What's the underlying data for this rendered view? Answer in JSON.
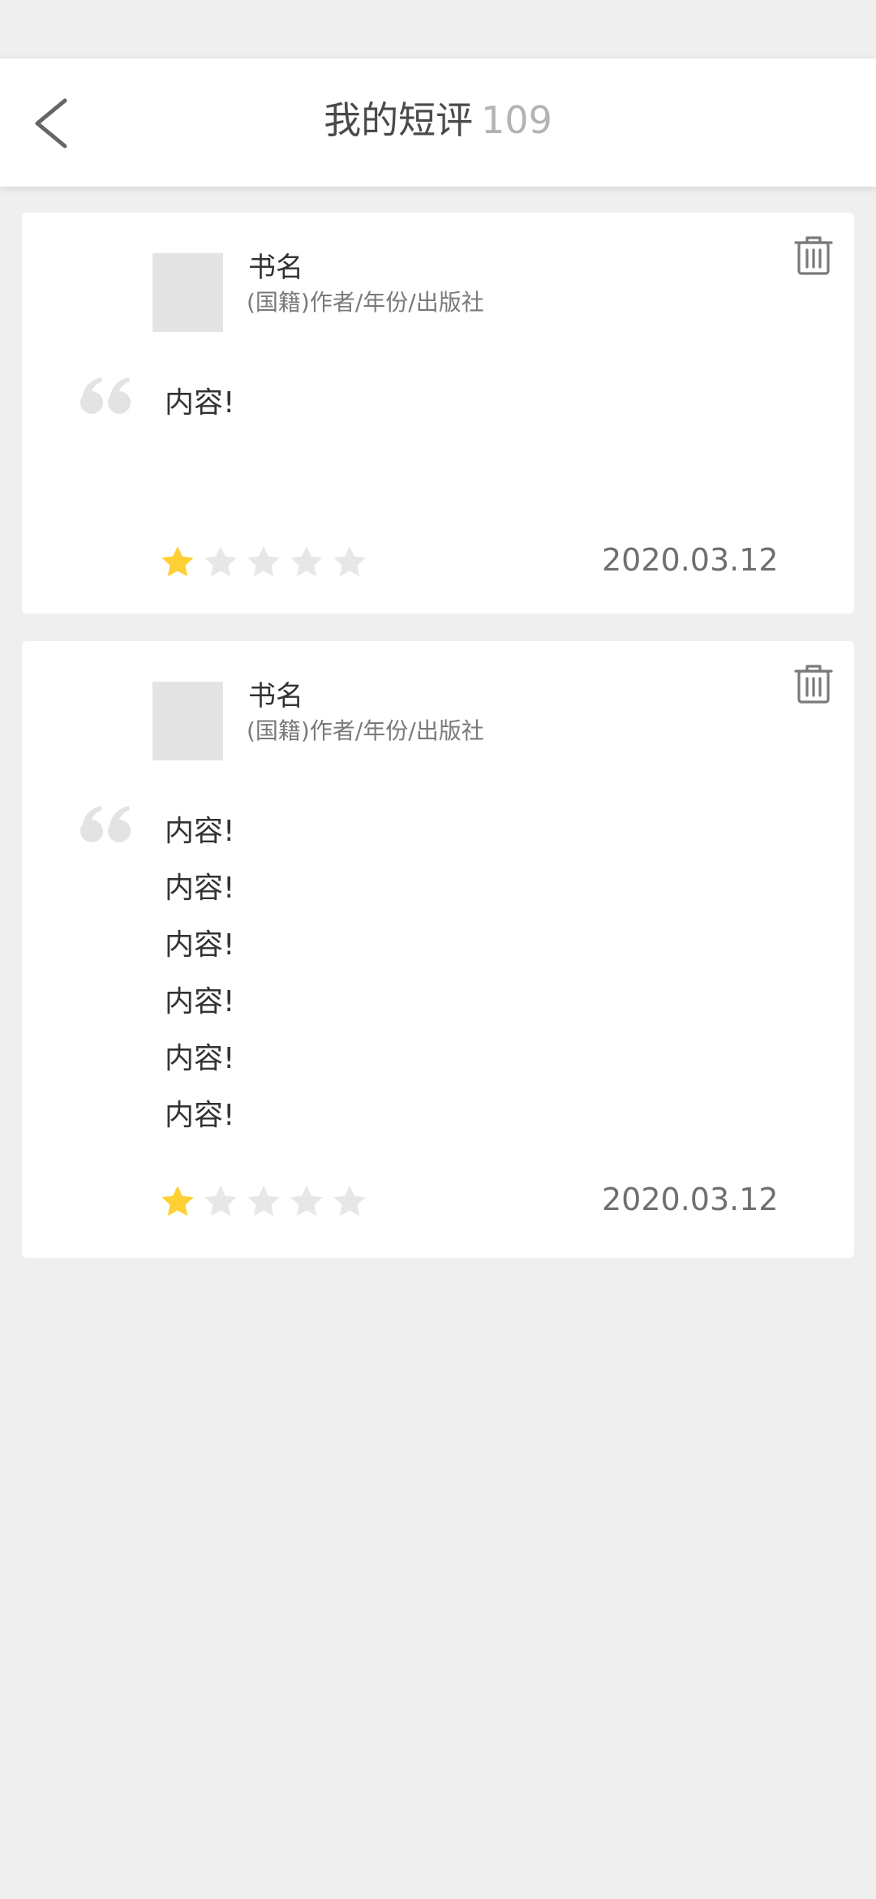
{
  "header": {
    "title": "我的短评",
    "count": "109",
    "back_icon": "chevron-left-icon"
  },
  "reviews": [
    {
      "book_title": "书名",
      "book_meta": "(国籍)作者/年份/出版社",
      "content_lines": [
        "内容!"
      ],
      "rating": 1,
      "rating_max": 5,
      "date": "2020.03.12"
    },
    {
      "book_title": "书名",
      "book_meta": "(国籍)作者/年份/出版社",
      "content_lines": [
        "内容!",
        "内容!",
        "内容!",
        "内容!",
        "内容!",
        "内容!"
      ],
      "rating": 1,
      "rating_max": 5,
      "date": "2020.03.12"
    }
  ],
  "colors": {
    "star_active": "#FFD035",
    "star_inactive": "#E7E7E7",
    "background": "#EFEFEF",
    "card": "#FFFFFF"
  }
}
